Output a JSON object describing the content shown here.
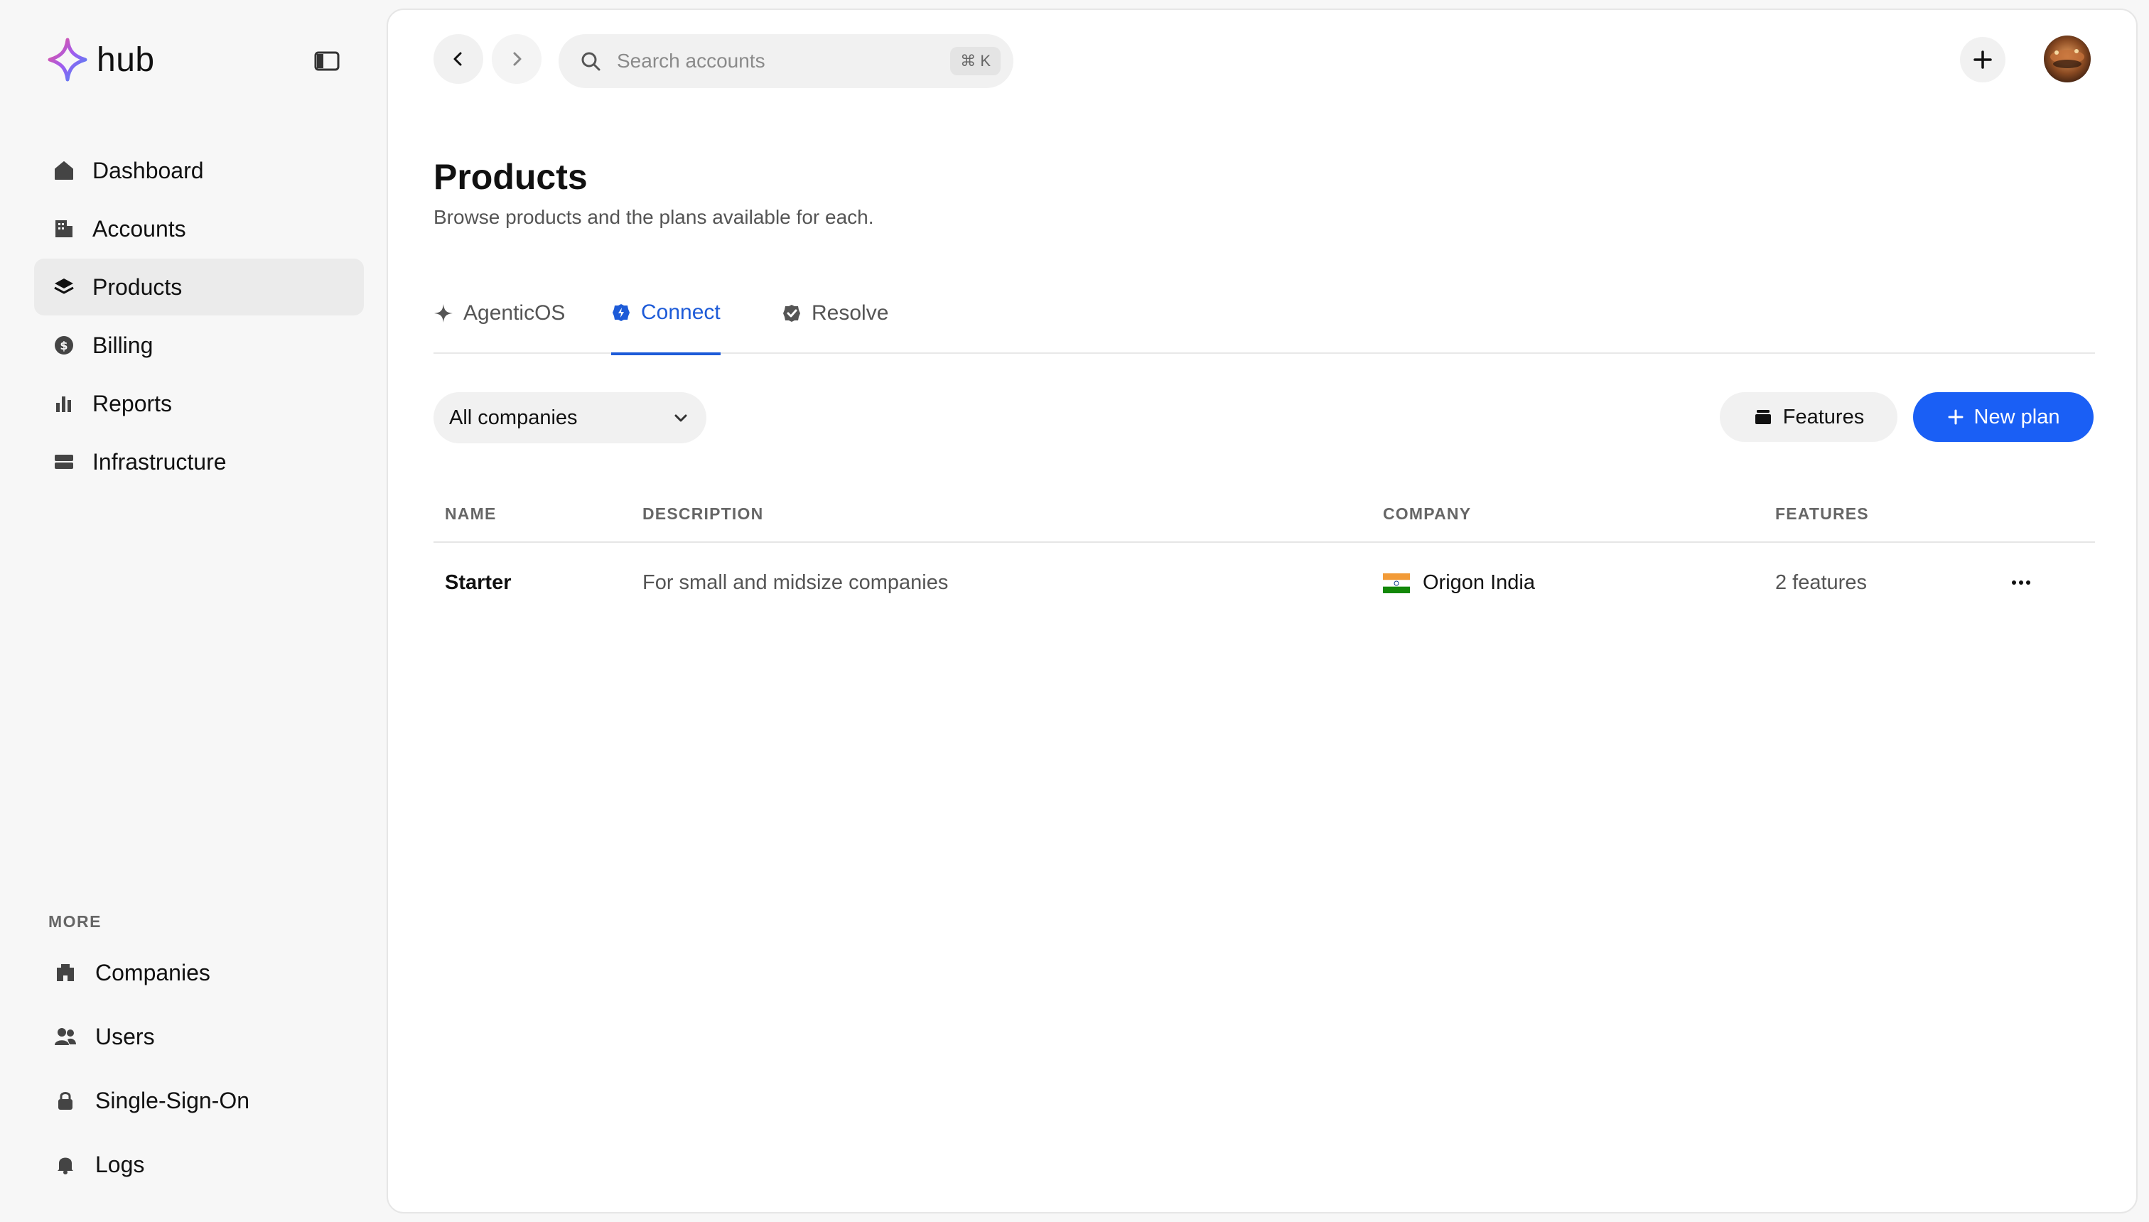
{
  "brand": {
    "name": "hub"
  },
  "sidebar": {
    "items": [
      {
        "label": "Dashboard",
        "icon": "home-icon",
        "active": false
      },
      {
        "label": "Accounts",
        "icon": "building-icon",
        "active": false
      },
      {
        "label": "Products",
        "icon": "layers-icon",
        "active": true
      },
      {
        "label": "Billing",
        "icon": "dollar-coin-icon",
        "active": false
      },
      {
        "label": "Reports",
        "icon": "bar-chart-icon",
        "active": false
      },
      {
        "label": "Infrastructure",
        "icon": "server-icon",
        "active": false
      }
    ],
    "more_title": "MORE",
    "more_items": [
      {
        "label": "Companies",
        "icon": "office-icon"
      },
      {
        "label": "Users",
        "icon": "users-icon"
      },
      {
        "label": "Single-Sign-On",
        "icon": "lock-icon"
      },
      {
        "label": "Logs",
        "icon": "bell-icon"
      }
    ]
  },
  "topbar": {
    "search_placeholder": "Search accounts",
    "search_shortcut": "⌘ K"
  },
  "page": {
    "title": "Products",
    "subtitle": "Browse products and the plans available for each."
  },
  "tabs": [
    {
      "label": "AgenticOS",
      "icon": "sparkle-icon",
      "active": false
    },
    {
      "label": "Connect",
      "icon": "connect-badge-icon",
      "active": true
    },
    {
      "label": "Resolve",
      "icon": "check-badge-icon",
      "active": false
    }
  ],
  "filters": {
    "company_select": "All companies",
    "features_button": "Features",
    "new_plan_button": "New plan"
  },
  "table": {
    "columns": [
      "NAME",
      "DESCRIPTION",
      "COMPANY",
      "FEATURES"
    ],
    "rows": [
      {
        "name": "Starter",
        "description": "For small and midsize companies",
        "company": "Origon India",
        "company_flag": "india-flag-icon",
        "features": "2 features"
      }
    ]
  },
  "colors": {
    "accent": "#1a5ff5",
    "active_tab": "#1d5bd8",
    "sidebar_bg": "#f7f7f7",
    "active_nav_bg": "#ebebeb"
  }
}
